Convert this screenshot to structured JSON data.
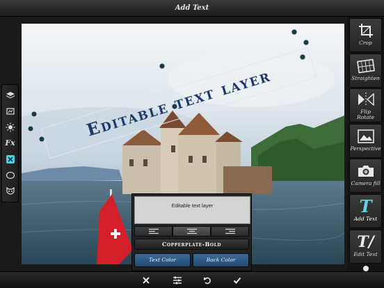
{
  "window": {
    "title": "Add Text"
  },
  "canvas": {
    "overlay_text": "Editable text layer",
    "text_color": "#1a3a6b"
  },
  "left_tools": [
    {
      "icon": "layers-icon"
    },
    {
      "icon": "frame-icon"
    },
    {
      "icon": "adjust-icon"
    },
    {
      "label": "Fx",
      "icon": "effects-icon"
    },
    {
      "icon": "tools-icon",
      "active": true
    },
    {
      "icon": "vignette-icon"
    },
    {
      "icon": "mask-icon"
    }
  ],
  "right_tools": [
    {
      "label": "Crop",
      "icon": "crop-icon"
    },
    {
      "label": "Straighten",
      "icon": "straighten-icon"
    },
    {
      "label": "Flip\nRotate",
      "label_line1": "Flip",
      "label_line2": "Rotate",
      "icon": "flip-rotate-icon"
    },
    {
      "label": "Perspective",
      "icon": "perspective-icon"
    },
    {
      "label": "Camera fill",
      "icon": "camera-fill-icon"
    },
    {
      "label": "Add Text",
      "icon": "add-text-icon",
      "active": true
    },
    {
      "label": "Edit Text",
      "icon": "edit-text-icon"
    }
  ],
  "text_panel": {
    "input_value": "Editable text layer",
    "font_name": "Copperplate-Bold",
    "text_color_label": "Text Color",
    "back_color_label": "Back Color",
    "alignment_selected": "center"
  },
  "bottom_bar": {
    "buttons": [
      "close-icon",
      "sliders-icon",
      "undo-icon",
      "checkmark-icon"
    ]
  },
  "colors": {
    "accent": "#4fd2e0",
    "button_blue": "#2e5a86"
  }
}
